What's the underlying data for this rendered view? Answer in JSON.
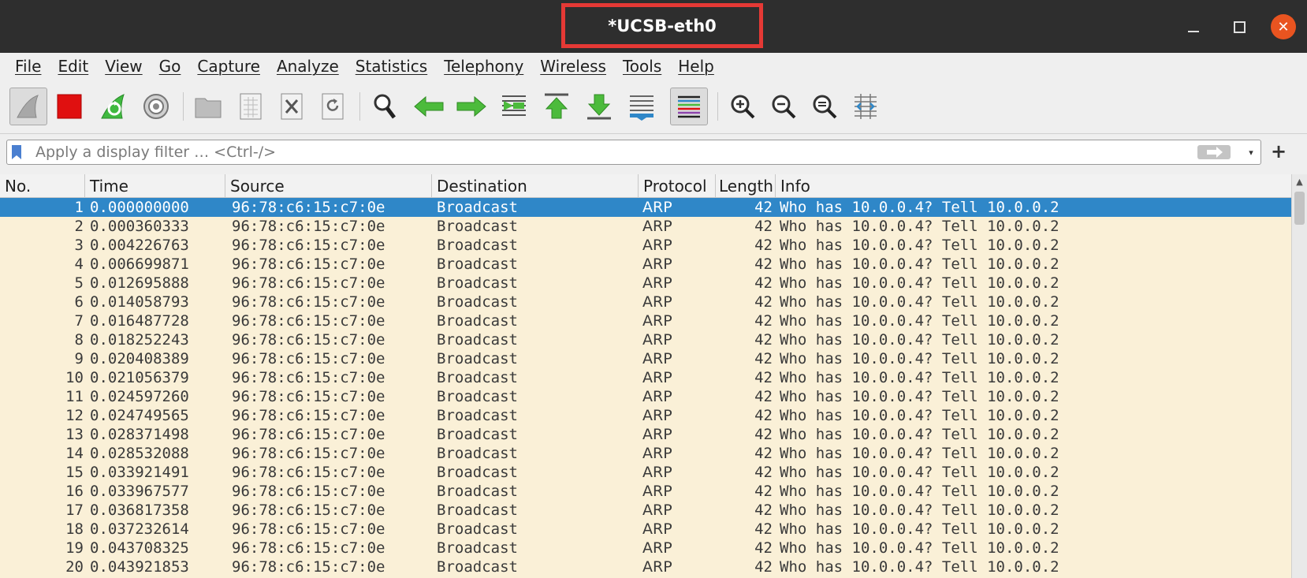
{
  "window": {
    "title": "*UCSB-eth0",
    "close_glyph": "✕"
  },
  "menu": [
    "File",
    "Edit",
    "View",
    "Go",
    "Capture",
    "Analyze",
    "Statistics",
    "Telephony",
    "Wireless",
    "Tools",
    "Help"
  ],
  "toolbar": {
    "icons": [
      "shark-fin-start-icon",
      "stop-capture-icon",
      "restart-capture-icon",
      "capture-options-icon",
      "open-file-icon",
      "save-file-icon",
      "close-file-icon",
      "reload-file-icon",
      "find-packet-icon",
      "go-back-icon",
      "go-forward-icon",
      "go-to-packet-icon",
      "first-packet-icon",
      "last-packet-icon",
      "auto-scroll-icon",
      "colorize-icon",
      "zoom-in-icon",
      "zoom-out-icon",
      "normal-size-icon",
      "resize-columns-icon"
    ],
    "colors": {
      "stop": "#e01010",
      "green": "#3fb93f",
      "selection": "#2f87c8",
      "row_bg": "#faf0d7"
    }
  },
  "filter": {
    "placeholder": "Apply a display filter … <Ctrl-/>",
    "add_glyph": "+",
    "dropdown_glyph": "▾"
  },
  "columns": [
    "No.",
    "Time",
    "Source",
    "Destination",
    "Protocol",
    "Length",
    "Info"
  ],
  "packets": [
    {
      "no": "1",
      "time": "0.000000000",
      "src": "96:78:c6:15:c7:0e",
      "dst": "Broadcast",
      "proto": "ARP",
      "len": "42",
      "info": "Who has 10.0.0.4? Tell 10.0.0.2"
    },
    {
      "no": "2",
      "time": "0.000360333",
      "src": "96:78:c6:15:c7:0e",
      "dst": "Broadcast",
      "proto": "ARP",
      "len": "42",
      "info": "Who has 10.0.0.4? Tell 10.0.0.2"
    },
    {
      "no": "3",
      "time": "0.004226763",
      "src": "96:78:c6:15:c7:0e",
      "dst": "Broadcast",
      "proto": "ARP",
      "len": "42",
      "info": "Who has 10.0.0.4? Tell 10.0.0.2"
    },
    {
      "no": "4",
      "time": "0.006699871",
      "src": "96:78:c6:15:c7:0e",
      "dst": "Broadcast",
      "proto": "ARP",
      "len": "42",
      "info": "Who has 10.0.0.4? Tell 10.0.0.2"
    },
    {
      "no": "5",
      "time": "0.012695888",
      "src": "96:78:c6:15:c7:0e",
      "dst": "Broadcast",
      "proto": "ARP",
      "len": "42",
      "info": "Who has 10.0.0.4? Tell 10.0.0.2"
    },
    {
      "no": "6",
      "time": "0.014058793",
      "src": "96:78:c6:15:c7:0e",
      "dst": "Broadcast",
      "proto": "ARP",
      "len": "42",
      "info": "Who has 10.0.0.4? Tell 10.0.0.2"
    },
    {
      "no": "7",
      "time": "0.016487728",
      "src": "96:78:c6:15:c7:0e",
      "dst": "Broadcast",
      "proto": "ARP",
      "len": "42",
      "info": "Who has 10.0.0.4? Tell 10.0.0.2"
    },
    {
      "no": "8",
      "time": "0.018252243",
      "src": "96:78:c6:15:c7:0e",
      "dst": "Broadcast",
      "proto": "ARP",
      "len": "42",
      "info": "Who has 10.0.0.4? Tell 10.0.0.2"
    },
    {
      "no": "9",
      "time": "0.020408389",
      "src": "96:78:c6:15:c7:0e",
      "dst": "Broadcast",
      "proto": "ARP",
      "len": "42",
      "info": "Who has 10.0.0.4? Tell 10.0.0.2"
    },
    {
      "no": "10",
      "time": "0.021056379",
      "src": "96:78:c6:15:c7:0e",
      "dst": "Broadcast",
      "proto": "ARP",
      "len": "42",
      "info": "Who has 10.0.0.4? Tell 10.0.0.2"
    },
    {
      "no": "11",
      "time": "0.024597260",
      "src": "96:78:c6:15:c7:0e",
      "dst": "Broadcast",
      "proto": "ARP",
      "len": "42",
      "info": "Who has 10.0.0.4? Tell 10.0.0.2"
    },
    {
      "no": "12",
      "time": "0.024749565",
      "src": "96:78:c6:15:c7:0e",
      "dst": "Broadcast",
      "proto": "ARP",
      "len": "42",
      "info": "Who has 10.0.0.4? Tell 10.0.0.2"
    },
    {
      "no": "13",
      "time": "0.028371498",
      "src": "96:78:c6:15:c7:0e",
      "dst": "Broadcast",
      "proto": "ARP",
      "len": "42",
      "info": "Who has 10.0.0.4? Tell 10.0.0.2"
    },
    {
      "no": "14",
      "time": "0.028532088",
      "src": "96:78:c6:15:c7:0e",
      "dst": "Broadcast",
      "proto": "ARP",
      "len": "42",
      "info": "Who has 10.0.0.4? Tell 10.0.0.2"
    },
    {
      "no": "15",
      "time": "0.033921491",
      "src": "96:78:c6:15:c7:0e",
      "dst": "Broadcast",
      "proto": "ARP",
      "len": "42",
      "info": "Who has 10.0.0.4? Tell 10.0.0.2"
    },
    {
      "no": "16",
      "time": "0.033967577",
      "src": "96:78:c6:15:c7:0e",
      "dst": "Broadcast",
      "proto": "ARP",
      "len": "42",
      "info": "Who has 10.0.0.4? Tell 10.0.0.2"
    },
    {
      "no": "17",
      "time": "0.036817358",
      "src": "96:78:c6:15:c7:0e",
      "dst": "Broadcast",
      "proto": "ARP",
      "len": "42",
      "info": "Who has 10.0.0.4? Tell 10.0.0.2"
    },
    {
      "no": "18",
      "time": "0.037232614",
      "src": "96:78:c6:15:c7:0e",
      "dst": "Broadcast",
      "proto": "ARP",
      "len": "42",
      "info": "Who has 10.0.0.4? Tell 10.0.0.2"
    },
    {
      "no": "19",
      "time": "0.043708325",
      "src": "96:78:c6:15:c7:0e",
      "dst": "Broadcast",
      "proto": "ARP",
      "len": "42",
      "info": "Who has 10.0.0.4? Tell 10.0.0.2"
    },
    {
      "no": "20",
      "time": "0.043921853",
      "src": "96:78:c6:15:c7:0e",
      "dst": "Broadcast",
      "proto": "ARP",
      "len": "42",
      "info": "Who has 10.0.0.4? Tell 10.0.0.2"
    }
  ],
  "selected_packet": "1"
}
